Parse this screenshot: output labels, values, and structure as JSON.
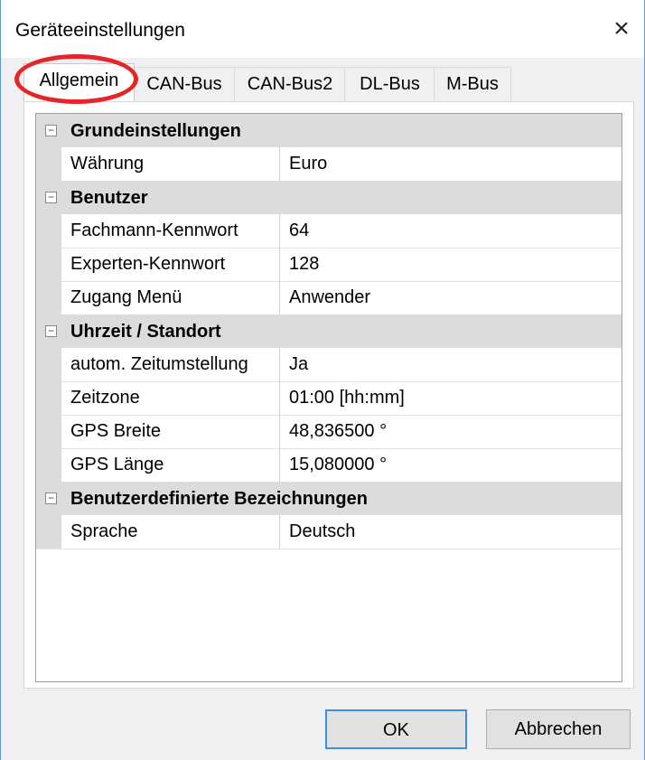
{
  "window": {
    "title": "Geräteeinstellungen",
    "close_icon": "×"
  },
  "tabs": [
    {
      "label": "Allgemein",
      "active": true
    },
    {
      "label": "CAN-Bus"
    },
    {
      "label": "CAN-Bus2"
    },
    {
      "label": "DL-Bus"
    },
    {
      "label": "M-Bus"
    }
  ],
  "sections": [
    {
      "label": "Grundeinstellungen",
      "toggle": "−",
      "rows": [
        {
          "name": "Währung",
          "value": "Euro"
        }
      ]
    },
    {
      "label": "Benutzer",
      "toggle": "−",
      "rows": [
        {
          "name": "Fachmann-Kennwort",
          "value": "64"
        },
        {
          "name": "Experten-Kennwort",
          "value": "128"
        },
        {
          "name": "Zugang Menü",
          "value": "Anwender"
        }
      ]
    },
    {
      "label": "Uhrzeit / Standort",
      "toggle": "−",
      "rows": [
        {
          "name": "autom. Zeitumstellung",
          "value": "Ja"
        },
        {
          "name": "Zeitzone",
          "value": "01:00 [hh:mm]"
        },
        {
          "name": "GPS Breite",
          "value": "48,836500 °"
        },
        {
          "name": "GPS Länge",
          "value": "15,080000 °"
        }
      ]
    },
    {
      "label": "Benutzerdefinierte Bezeichnungen",
      "toggle": "−",
      "rows": [
        {
          "name": "Sprache",
          "value": "Deutsch"
        }
      ]
    }
  ],
  "buttons": {
    "ok": "OK",
    "cancel": "Abbrechen"
  },
  "colors": {
    "highlight_circle": "#e4252a",
    "section_bg": "#dcdcdc",
    "default_button_border": "#3a8ee6"
  }
}
